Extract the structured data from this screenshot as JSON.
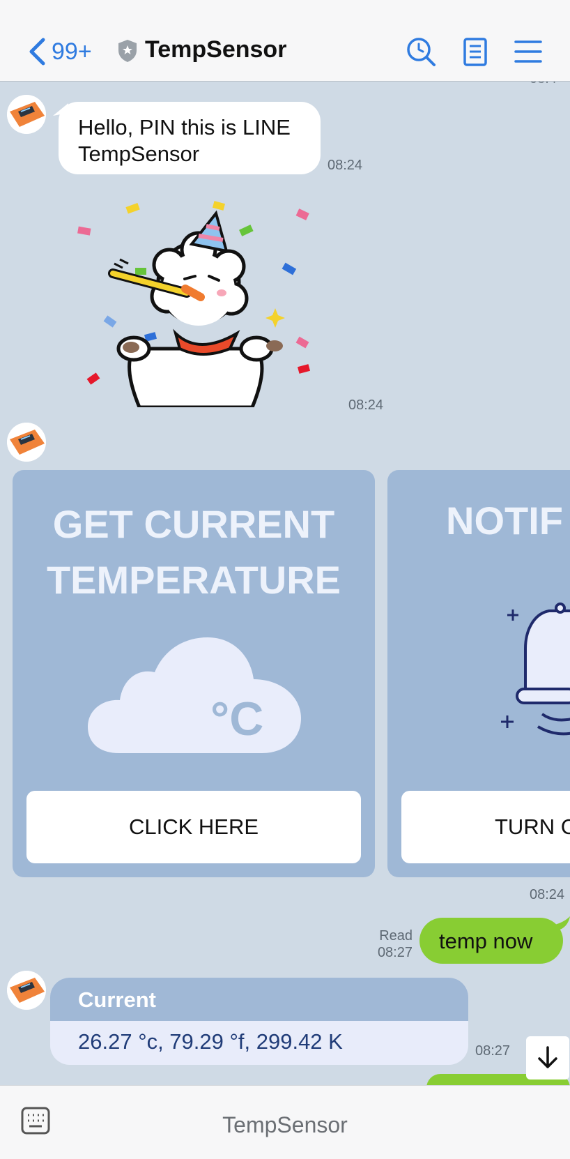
{
  "header": {
    "back_count": "99+",
    "title": "TempSensor"
  },
  "messages": {
    "top_time": "08:4",
    "greeting": {
      "text": "Hello, PIN this is LINE TempSensor",
      "time": "08:24"
    },
    "sticker": {
      "time": "08:24"
    },
    "carousel": {
      "time": "08:24",
      "cards": [
        {
          "title_line1": "GET CURRENT",
          "title_line2": "TEMPERATURE",
          "icon_label": "°C",
          "button": "CLICK HERE"
        },
        {
          "title_line1": "NOTIF",
          "button": "TURN C"
        }
      ]
    },
    "outgoing": {
      "text": "temp now",
      "read_label": "Read",
      "time": "08:27"
    },
    "current": {
      "header": "Current",
      "value": "26.27 °c, 79.29 °f, 299.42 K",
      "time": "08:27"
    }
  },
  "bottom": {
    "title": "TempSensor"
  },
  "colors": {
    "accent": "#2f7be0",
    "chat_bg": "#cfdae5",
    "outgoing": "#88cd33",
    "card": "#9fb8d6"
  }
}
